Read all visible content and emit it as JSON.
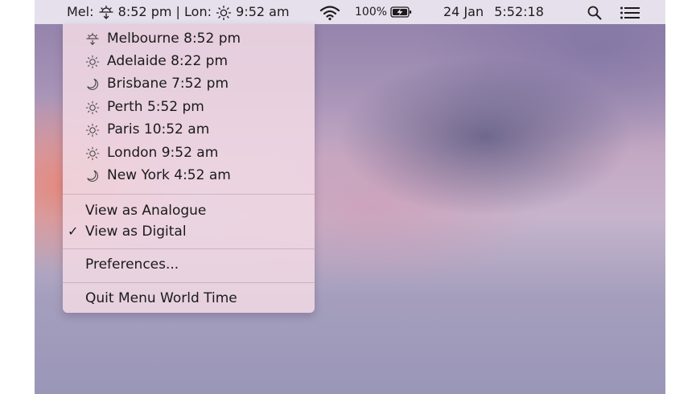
{
  "menubar": {
    "world_time": {
      "mel_prefix": "Mel:",
      "mel_time": "8:52 pm",
      "divider": "|",
      "lon_prefix": "Lon:",
      "lon_time": "9:52 am"
    },
    "battery_percent": "100%",
    "clock_date": "24 Jan",
    "clock_time": "5:52:18",
    "icons": [
      "sunset-icon",
      "sun-icon",
      "wifi-icon",
      "battery-charging-icon",
      "search-icon",
      "notification-center-icon"
    ]
  },
  "dropdown": {
    "cities": [
      {
        "label": "Melbourne 8:52 pm",
        "icon": "sunset-icon"
      },
      {
        "label": "Adelaide 8:22 pm",
        "icon": "sun-icon"
      },
      {
        "label": "Brisbane 7:52 pm",
        "icon": "moon-icon"
      },
      {
        "label": "Perth 5:52 pm",
        "icon": "sun-icon"
      },
      {
        "label": "Paris 10:52 am",
        "icon": "sun-icon"
      },
      {
        "label": "London 9:52 am",
        "icon": "sun-icon"
      },
      {
        "label": "New York 4:52 am",
        "icon": "moon-icon"
      }
    ],
    "view_analogue": "View as Analogue",
    "view_digital": "View as Digital",
    "check_mark": "✓",
    "preferences": "Preferences...",
    "quit": "Quit Menu World Time"
  }
}
